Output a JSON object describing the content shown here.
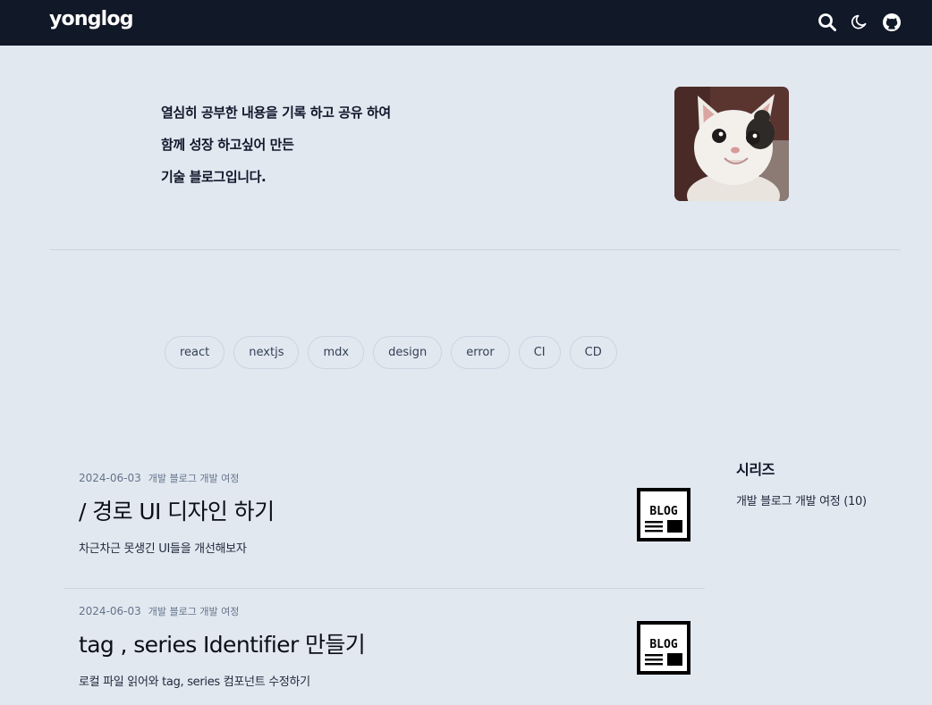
{
  "header": {
    "logo": "yonglog",
    "icons": [
      "search-icon",
      "moon-icon",
      "github-icon"
    ],
    "background": "#111827"
  },
  "intro": {
    "lines": [
      "열심히 공부한 내용을 기록 하고 공유 하여",
      "함께 성장 하고싶어 만든",
      "기술 블로그입니다."
    ]
  },
  "tags": [
    "react",
    "nextjs",
    "mdx",
    "design",
    "error",
    "CI",
    "CD"
  ],
  "posts": [
    {
      "date": "2024-06-03",
      "series": "개발 블로그 개발 여정",
      "title": "/ 경로 UI 디자인 하기",
      "description": "차근차근 못생긴 UI들을 개선해보자",
      "thumbnail_text": "BLOG"
    },
    {
      "date": "2024-06-03",
      "series": "개발 블로그 개발 여정",
      "title": "tag , series Identifier 만들기",
      "description": "로컬 파일 읽어와 tag, series 컴포넌트 수정하기",
      "thumbnail_text": "BLOG"
    }
  ],
  "sidebar": {
    "title": "시리즈",
    "items": [
      "개발 블로그 개발 여정 (10)"
    ]
  },
  "colors": {
    "page_background": "#e2e8f0",
    "header_background": "#111827",
    "divider": "#cbd5e1"
  }
}
